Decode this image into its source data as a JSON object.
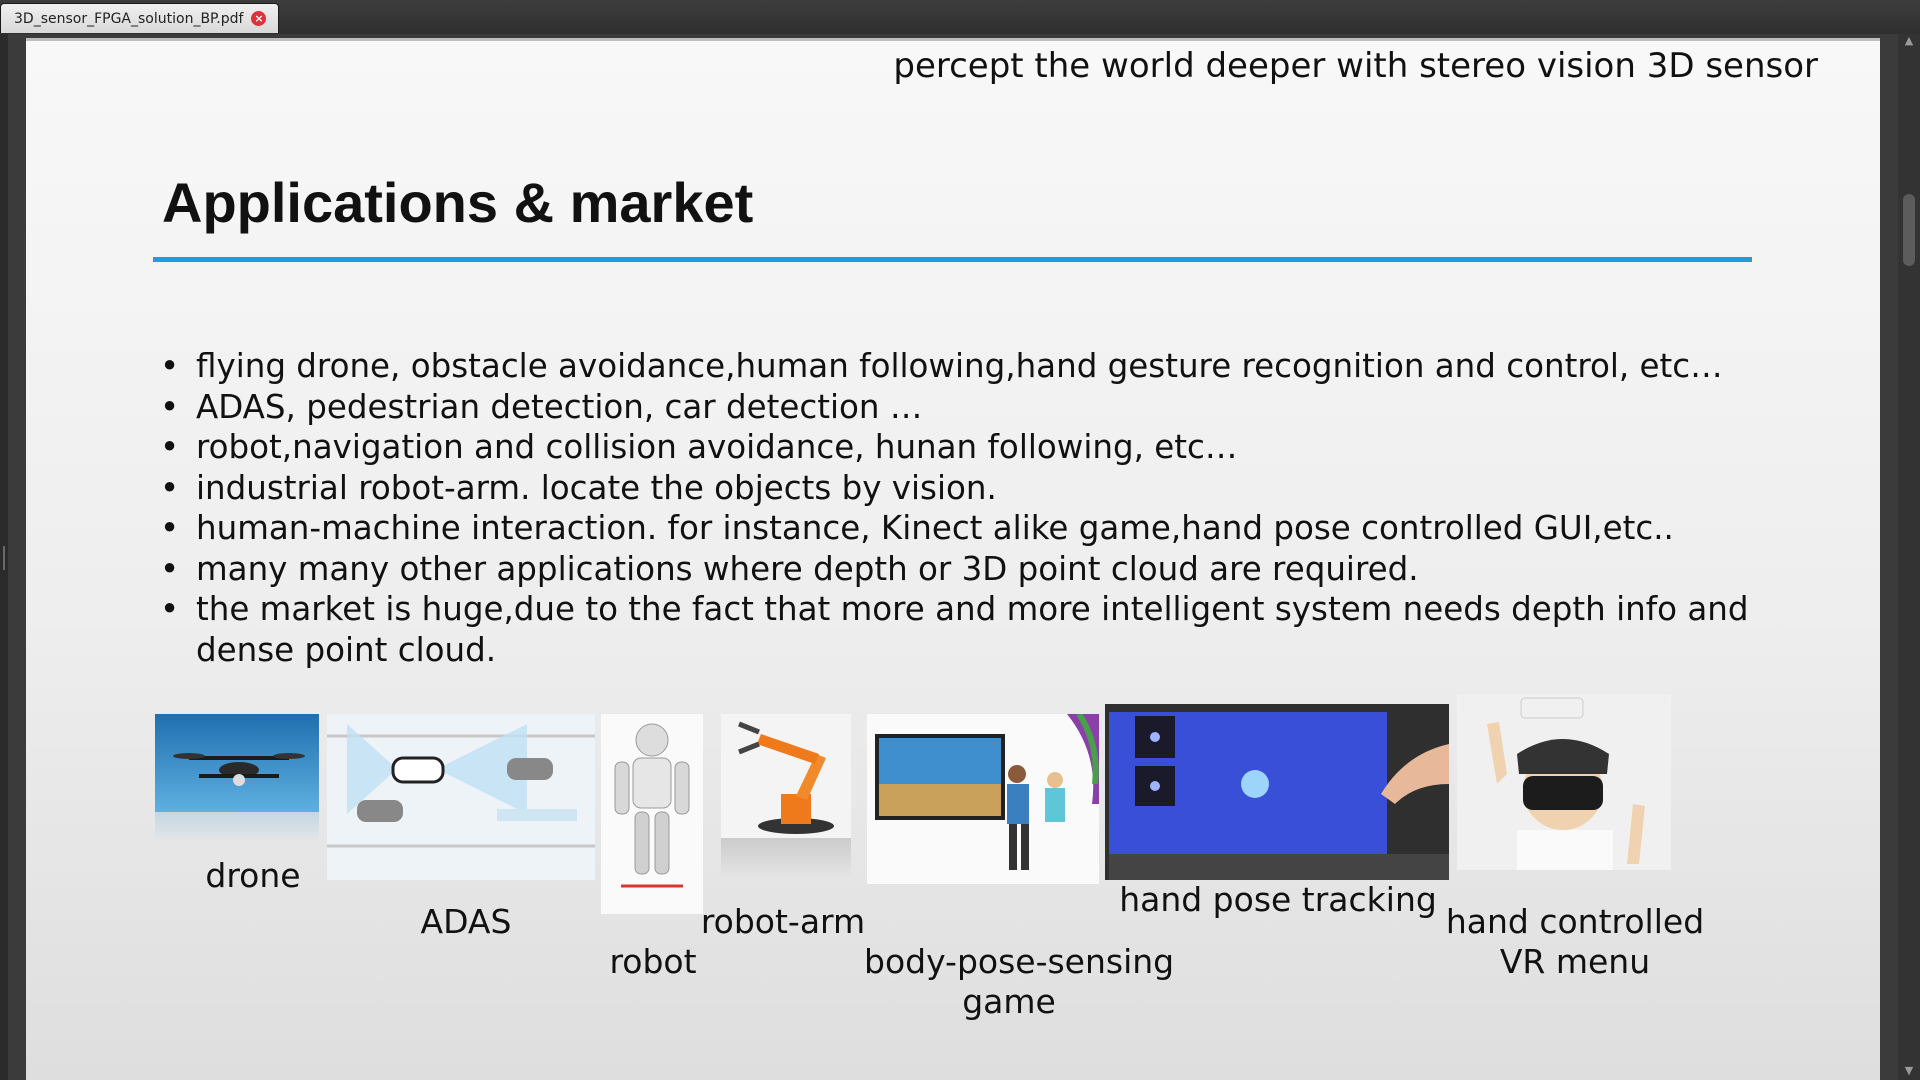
{
  "tab": {
    "filename": "3D_sensor_FPGA_solution_BP.pdf",
    "close_glyph": "×"
  },
  "slide": {
    "header_text": "percept the world deeper with stereo vision 3D sensor",
    "title": "Applications & market",
    "accent_color": "#1a9fdc",
    "bullets": [
      "flying drone, obstacle avoidance,human following,hand gesture recognition and control, etc…",
      "ADAS, pedestrian detection, car detection …",
      "robot,navigation and collision avoidance, hunan following, etc…",
      "industrial robot-arm. locate the objects by vision.",
      "human-machine interaction. for instance, Kinect alike game,hand pose controlled GUI,etc..",
      "many many other applications where depth or 3D point cloud are required.",
      "the market is huge,due to the fact that more and more intelligent system needs depth info and dense point cloud."
    ],
    "images": [
      {
        "caption": "drone"
      },
      {
        "caption": "ADAS"
      },
      {
        "caption": "robot"
      },
      {
        "caption": "robot-arm"
      },
      {
        "caption_line1": "body-pose-sensing",
        "caption_line2": "game"
      },
      {
        "caption": "hand pose tracking"
      },
      {
        "caption_line1": "hand controlled",
        "caption_line2": "VR menu"
      }
    ]
  },
  "scrollbar": {
    "up_icon": "chevron-up-icon",
    "down_icon": "chevron-down-icon"
  }
}
